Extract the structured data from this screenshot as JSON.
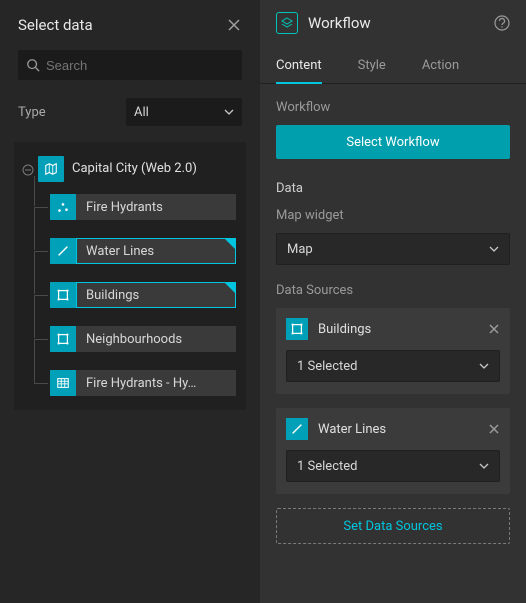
{
  "left": {
    "title": "Select data",
    "searchPlaceholder": "Search",
    "typeLabel": "Type",
    "typeValue": "All",
    "root": {
      "label": "Capital City (Web 2.0)"
    },
    "layers": [
      {
        "label": "Fire Hydrants",
        "iconType": "point",
        "selected": false
      },
      {
        "label": "Water Lines",
        "iconType": "line",
        "selected": true
      },
      {
        "label": "Buildings",
        "iconType": "polygon",
        "selected": true
      },
      {
        "label": "Neighbourhoods",
        "iconType": "polygon",
        "selected": false
      },
      {
        "label": "Fire Hydrants - Hy…",
        "iconType": "table",
        "selected": false
      }
    ]
  },
  "right": {
    "title": "Workflow",
    "tabs": [
      {
        "label": "Content",
        "active": true
      },
      {
        "label": "Style",
        "active": false
      },
      {
        "label": "Action",
        "active": false
      }
    ],
    "sections": {
      "workflowLabel": "Workflow",
      "selectWorkflowBtn": "Select Workflow",
      "dataLabel": "Data",
      "mapWidgetLabel": "Map widget",
      "mapWidgetValue": "Map",
      "dataSourcesLabel": "Data Sources",
      "dataSources": [
        {
          "name": "Buildings",
          "iconType": "polygon",
          "selected": "1 Selected"
        },
        {
          "name": "Water Lines",
          "iconType": "line",
          "selected": "1 Selected"
        }
      ],
      "setDataSourcesBtn": "Set Data Sources"
    }
  }
}
